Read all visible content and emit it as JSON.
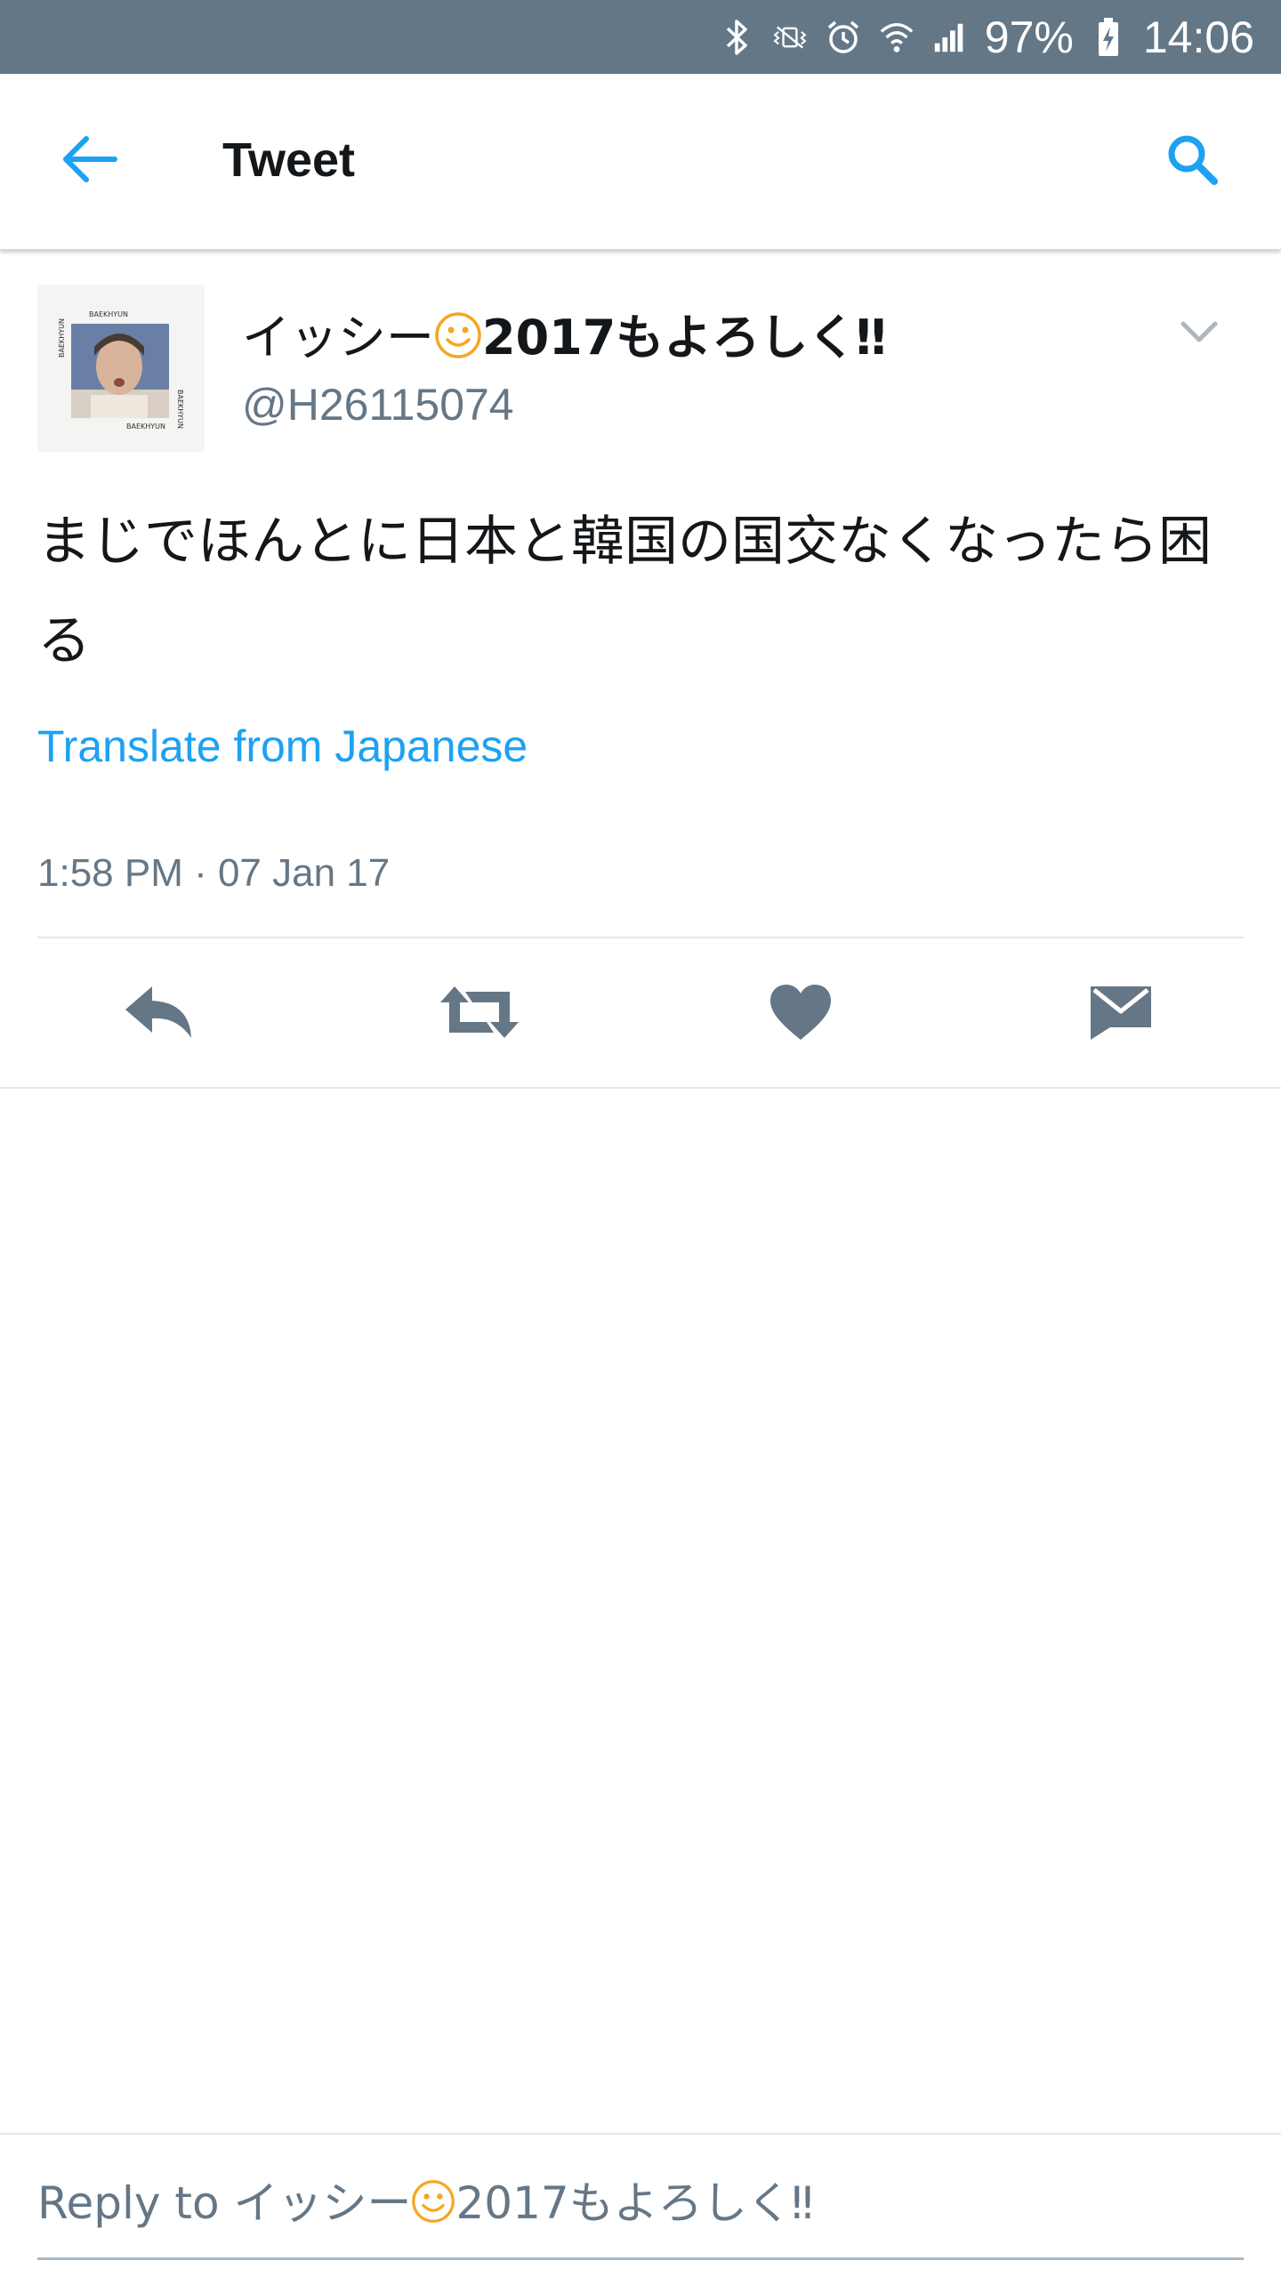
{
  "status_bar": {
    "icons": [
      "bluetooth-icon",
      "vibrate-icon",
      "alarm-icon",
      "wifi-icon",
      "signal-icon",
      "battery-charging-icon"
    ],
    "battery": "97%",
    "time": "14:06"
  },
  "app_bar": {
    "title": "Tweet",
    "back_icon": "arrow-left-icon",
    "search_icon": "search-icon"
  },
  "tweet": {
    "display_name_prefix": "イッシー",
    "display_name_emoji": "smiley-icon",
    "display_name_suffix": "2017もよろしく‼",
    "handle": "@H26115074",
    "text": "まじでほんとに日本と韓国の国交なくなったら困る",
    "translate_label": "Translate from Japanese",
    "timestamp": "1:58 PM · 07 Jan 17",
    "menu_icon": "chevron-down-icon"
  },
  "actions": [
    {
      "name": "reply",
      "icon": "reply-icon"
    },
    {
      "name": "retweet",
      "icon": "retweet-icon"
    },
    {
      "name": "like",
      "icon": "heart-icon"
    },
    {
      "name": "direct-message",
      "icon": "envelope-icon"
    }
  ],
  "reply_box": {
    "prefix": "Reply to",
    "name_prefix": "イッシー",
    "name_suffix": "2017もよろしく‼"
  },
  "colors": {
    "status_bar": "#647787",
    "accent": "#1da1f2",
    "icon_gray": "#657786",
    "text": "#14171a",
    "smiley": "#f5a623"
  }
}
